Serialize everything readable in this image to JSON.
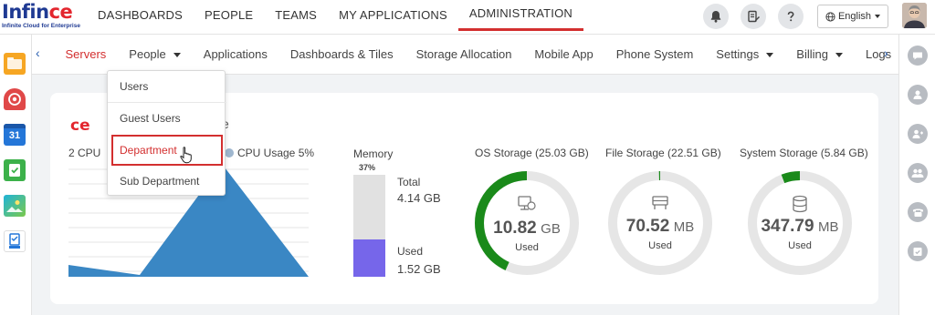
{
  "logo": {
    "part1": "Infin",
    "part2": "ce",
    "tagline": "Infinite Cloud for Enterprise"
  },
  "topnav": [
    {
      "label": "DASHBOARDS"
    },
    {
      "label": "PEOPLE"
    },
    {
      "label": "TEAMS"
    },
    {
      "label": "MY APPLICATIONS"
    },
    {
      "label": "ADMINISTRATION",
      "active": true
    }
  ],
  "header": {
    "language": "English"
  },
  "leftbar_apps": [
    "folder-app-icon",
    "mail-app-icon",
    "calendar-app-icon",
    "tasks-app-icon",
    "photos-app-icon",
    "docs-app-icon"
  ],
  "leftbar_labels": {
    "calendar_day": "31"
  },
  "subnav": {
    "items": [
      {
        "label": "Servers",
        "active": true
      },
      {
        "label": "People",
        "dropdown": true
      },
      {
        "label": "Applications"
      },
      {
        "label": "Dashboards & Tiles"
      },
      {
        "label": "Storage Allocation"
      },
      {
        "label": "Mobile App"
      },
      {
        "label": "Phone System"
      },
      {
        "label": "Settings",
        "dropdown": true
      },
      {
        "label": "Billing",
        "dropdown": true
      },
      {
        "label": "Logs"
      }
    ]
  },
  "people_menu": [
    "Users",
    "Guest Users",
    "Department",
    "Sub Department"
  ],
  "card": {
    "logo": "ce",
    "title_visible": "e",
    "cpu": {
      "label": "2 CPU",
      "usage_label": "CPU Usage 5%"
    },
    "memory": {
      "label": "Memory",
      "percent_label": "37%",
      "percent": 37,
      "total_label": "Total",
      "total_value": "4.14 GB",
      "used_label": "Used",
      "used_value": "1.52 GB"
    },
    "storages": [
      {
        "title": "OS Storage (25.03 GB)",
        "value": "10.82",
        "unit": "GB",
        "sub": "Used",
        "fraction": 0.432,
        "icon": "server-icon"
      },
      {
        "title": "File Storage (22.51 GB)",
        "value": "70.52",
        "unit": "MB",
        "sub": "Used",
        "fraction": 0.003,
        "icon": "files-icon"
      },
      {
        "title": "System Storage (5.84 GB)",
        "value": "347.79",
        "unit": "MB",
        "sub": "Used",
        "fraction": 0.058,
        "icon": "database-icon"
      }
    ]
  },
  "colors": {
    "accent": "#d32f2f",
    "cpu_area": "#3a87c4",
    "memory_used": "#7666ea",
    "storage_arc": "#1a8a1a",
    "ring_track": "#e6e6e6",
    "brand_blue": "#1f3a93"
  }
}
